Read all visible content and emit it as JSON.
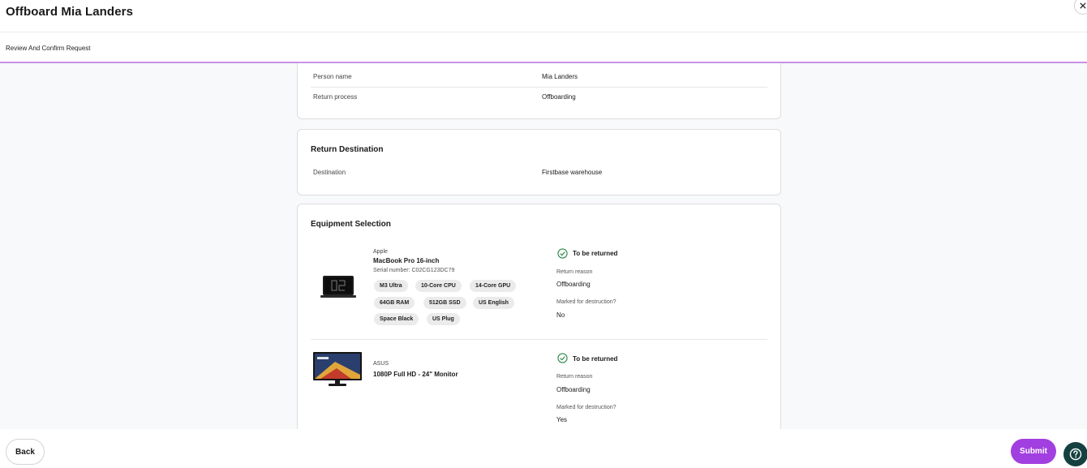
{
  "header": {
    "title": "Offboard Mia Landers",
    "close_icon": "close-icon"
  },
  "subheader": {
    "step_label": "Review And Confirm Request"
  },
  "person_card": {
    "rows": [
      {
        "label": "Person name",
        "value": "Mia Landers"
      },
      {
        "label": "Return process",
        "value": "Offboarding"
      }
    ]
  },
  "destination_card": {
    "title": "Return Destination",
    "label": "Destination",
    "value": "Firstbase warehouse"
  },
  "equipment_card": {
    "title": "Equipment Selection",
    "items": [
      {
        "brand": "Apple",
        "model": "MacBook Pro 16-inch",
        "serial": "Serial number: C02CG123DC79",
        "specs": [
          "M3 Ultra",
          "10-Core CPU",
          "14-Core GPU",
          "64GB RAM",
          "512GB SSD",
          "US English",
          "Space Black",
          "US Plug"
        ],
        "status": "To be returned",
        "reason_label": "Return reason",
        "reason_value": "Offboarding",
        "destruction_label": "Marked for destruction?",
        "destruction_value": "No"
      },
      {
        "brand": "ASUS",
        "model": "1080P Full HD - 24\" Monitor",
        "status": "To be returned",
        "reason_label": "Return reason",
        "reason_value": "Offboarding",
        "destruction_label": "Marked for destruction?",
        "destruction_value": "Yes"
      }
    ]
  },
  "footer": {
    "back_label": "Back",
    "submit_label": "Submit",
    "help_icon": "help-icon"
  },
  "colors": {
    "accent": "#a23fe0",
    "progress_line": "#c793e4",
    "success": "#2e8b4a",
    "help_button": "#154040"
  }
}
